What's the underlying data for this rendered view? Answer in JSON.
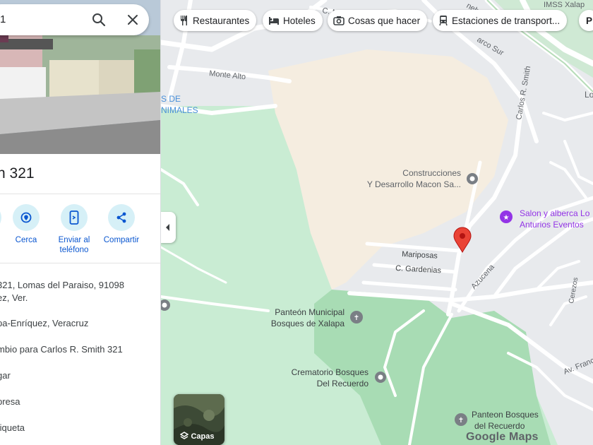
{
  "search": {
    "query": "1"
  },
  "place": {
    "title": "n 321",
    "actions": [
      {
        "label": "Cerca",
        "icon": "nearby-icon"
      },
      {
        "label": "Enviar al teléfono",
        "icon": "send-to-phone-icon"
      },
      {
        "label": "Compartir",
        "icon": "share-icon"
      }
    ],
    "info": [
      {
        "text": "321, Lomas del Paraiso, 91098"
      },
      {
        "text": "ez, Ver."
      },
      {
        "text": "pa-Enríquez, Veracruz"
      },
      {
        "text": "mbio para Carlos R. Smith 321"
      },
      {
        "text": "gar"
      },
      {
        "text": "presa"
      },
      {
        "text": "tiqueta"
      }
    ]
  },
  "chips": [
    {
      "label": "Restaurantes",
      "icon": "restaurant-icon"
    },
    {
      "label": "Hoteles",
      "icon": "hotel-icon"
    },
    {
      "label": "Cosas que hacer",
      "icon": "camera-icon"
    },
    {
      "label": "Estaciones de transport...",
      "icon": "transit-icon"
    },
    {
      "label": "P",
      "icon": ""
    }
  ],
  "map_labels": {
    "monte_alto": "Monte Alto",
    "de": "S DE",
    "animales": "NIMALES",
    "c_mo": "C. Mo",
    "nebs": "nebs",
    "arco_sur": "arco Sur",
    "imss": "IMSS Xalap",
    "lo": "Lo",
    "carlos_smith": "Carlos R. Smith",
    "construcciones_1": "Construcciones",
    "construcciones_2": "Y Desarrollo Macon Sa...",
    "salon_1": "Salon y alberca Lo",
    "salon_2": "Anturios Eventos",
    "mariposas": "Mariposas",
    "gardenias": "C. Gardenias",
    "azucena": "Azucena",
    "cerezos": "Cerezos",
    "panteon_1": "Panteón Municipal",
    "panteon_2": "Bosques de Xalapa",
    "crematorio_1": "Crematorio Bosques",
    "crematorio_2": "Del Recuerdo",
    "panteon_bosques_1": "Panteon Bosques",
    "panteon_bosques_2": "del Recuerdo",
    "av_franco": "Av. Franc"
  },
  "layers_label": "Capas",
  "brand": "Google Maps",
  "colors": {
    "marker": "#ea4335",
    "park": "#c9ecd3",
    "park_dark": "#a8dcb4",
    "sand": "#f5ede0",
    "road": "#ffffff",
    "poi_text": "#5f6368",
    "purple": "#9334e6",
    "water_text": "#4a90d9"
  }
}
